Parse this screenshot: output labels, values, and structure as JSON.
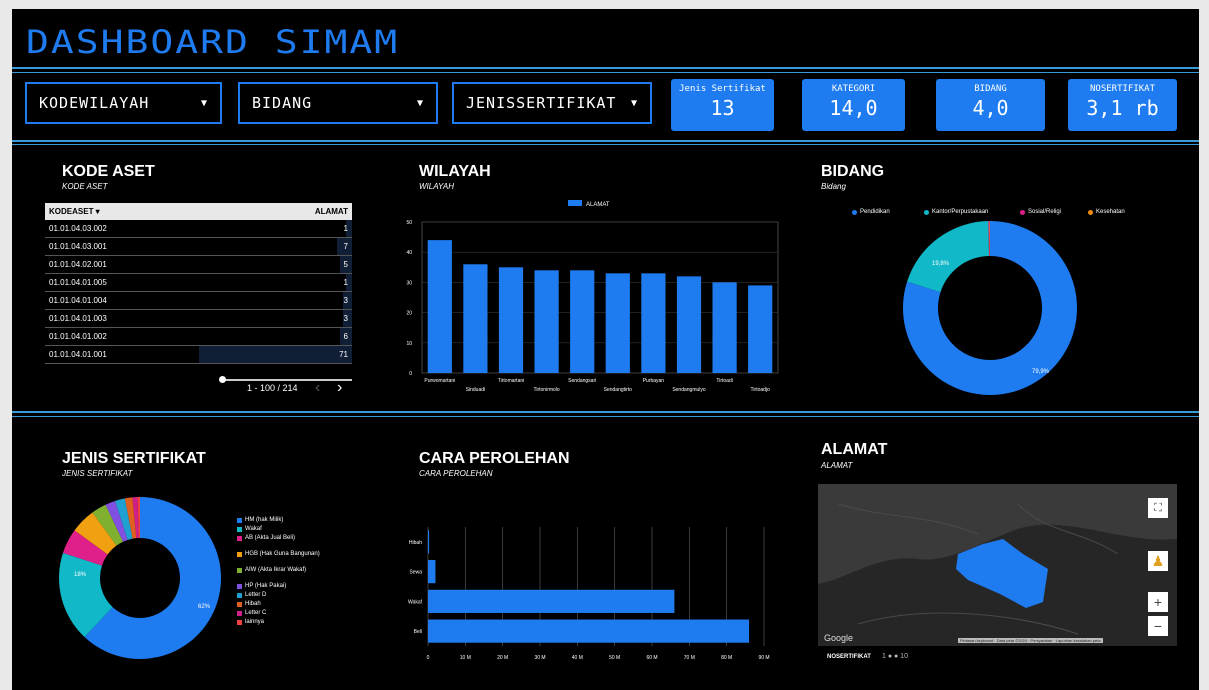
{
  "header": {
    "title": "DASHBOARD SIMAM"
  },
  "filters": [
    {
      "label": "KODEWILAYAH"
    },
    {
      "label": "BIDANG"
    },
    {
      "label": "JENISSERTIFIKAT"
    }
  ],
  "kpis": [
    {
      "label": "Jenis Sertifikat",
      "value": "13"
    },
    {
      "label": "KATEGORI",
      "value": "14,0"
    },
    {
      "label": "BIDANG",
      "value": "4,0"
    },
    {
      "label": "NOSERTIFIKAT",
      "value": "3,1 rb"
    }
  ],
  "kode_aset": {
    "title": "KODE ASET",
    "subtitle": "KODE ASET",
    "columns": [
      "KODEASET ▾",
      "ALAMAT"
    ],
    "rows": [
      {
        "kode": "01.01.04.03.002",
        "alamat": "1"
      },
      {
        "kode": "01.01.04.03.001",
        "alamat": "7"
      },
      {
        "kode": "01.01.04.02.001",
        "alamat": "5"
      },
      {
        "kode": "01.01.04.01.005",
        "alamat": "1"
      },
      {
        "kode": "01.01.04.01.004",
        "alamat": "3"
      },
      {
        "kode": "01.01.04.01.003",
        "alamat": "3"
      },
      {
        "kode": "01.01.04.01.002",
        "alamat": "6"
      },
      {
        "kode": "01.01.04.01.001",
        "alamat": "71"
      }
    ],
    "pagination": "1 - 100 / 214"
  },
  "wilayah": {
    "title": "WILAYAH",
    "subtitle": "WILAYAH",
    "legend": "ALAMAT",
    "categories_row1": [
      "Purwomartani",
      "Tirtomartani",
      "Sendangsari",
      "Purbayan",
      "Tirtoadi"
    ],
    "categories_row2": [
      "Sinduadi",
      "Tirtonirmolo",
      "Sendangtirto",
      "Sendangmulyo",
      "Tirtoadjo"
    ]
  },
  "bidang": {
    "title": "BIDANG",
    "subtitle": "Bidang",
    "slice_labels": [
      "19,8%",
      "79,9%"
    ]
  },
  "jenis_sertifikat": {
    "title": "JENIS SERTIFIKAT",
    "subtitle": "JENIS SERTIFIKAT",
    "slice_labels": [
      "62%",
      "18%"
    ]
  },
  "cara_perolehan": {
    "title": "CARA PEROLEHAN",
    "subtitle": "CARA PEROLEHAN"
  },
  "alamat": {
    "title": "ALAMAT",
    "subtitle": "ALAMAT",
    "google_label": "Google",
    "attribution": "Pintasan keyboard · Data peta ©2024 · Persyaratan · Laporkan kesalahan peta",
    "map_legend_label": "NOSERTIFIKAT",
    "map_legend_range": "1 ● ● 10"
  },
  "chart_data": [
    {
      "type": "bar",
      "title": "WILAYAH",
      "categories": [
        "Purwomartani",
        "Sinduadi",
        "Tirtomartani",
        "Tirtonirmolo",
        "Sendangsari",
        "Sendangtirto",
        "Purbayan",
        "Sendangmulyo",
        "Tirtoadi",
        "Tirtoadjo"
      ],
      "series": [
        {
          "name": "ALAMAT",
          "values": [
            44,
            36,
            35,
            34,
            34,
            33,
            33,
            32,
            30,
            29
          ]
        }
      ],
      "ylim": [
        0,
        50
      ],
      "yticks": [
        "0",
        "10",
        "20",
        "30",
        "40",
        "50"
      ],
      "color": "#1e7cf0"
    },
    {
      "type": "pie",
      "title": "BIDANG",
      "categories": [
        "Pendidikan",
        "Kantor/Perpustakaan",
        "Sosial/Religi",
        "Kesehatan"
      ],
      "values": [
        79.9,
        19.8,
        0.2,
        0.1
      ],
      "colors": [
        "#1e7cf0",
        "#10b8c8",
        "#e0208a",
        "#f08a10"
      ]
    },
    {
      "type": "pie",
      "title": "JENIS SERTIFIKAT",
      "categories": [
        "HM (hak Milik)",
        "Wakaf",
        "AB (Akta Jual Beli)",
        "HGB (Hak Guna Bangunan)",
        "AIW (Akta Ikrar Wakaf)",
        "HP (Hak Pakai)",
        "Letter D",
        "Hibah",
        "Letter C",
        "lainnya"
      ],
      "values": [
        62,
        18,
        5,
        5,
        3,
        2,
        2,
        1.5,
        1,
        0.5
      ],
      "colors": [
        "#1e7cf0",
        "#10b8c8",
        "#e0208a",
        "#f0a010",
        "#80b030",
        "#8050e0",
        "#20a0d0",
        "#e06020",
        "#d0208a",
        "#f04040"
      ]
    },
    {
      "type": "bar",
      "title": "CARA PEROLEHAN",
      "orientation": "horizontal",
      "categories": [
        "Hibah",
        "Sewa",
        "Wakaf",
        "Beli"
      ],
      "values": [
        0.3,
        2,
        66,
        86
      ],
      "xlim": [
        0,
        90
      ],
      "xticks": [
        "0",
        "10 M",
        "20 M",
        "30 M",
        "40 M",
        "50 M",
        "60 M",
        "70 M",
        "80 M",
        "90 M"
      ],
      "color": "#1e7cf0"
    }
  ]
}
